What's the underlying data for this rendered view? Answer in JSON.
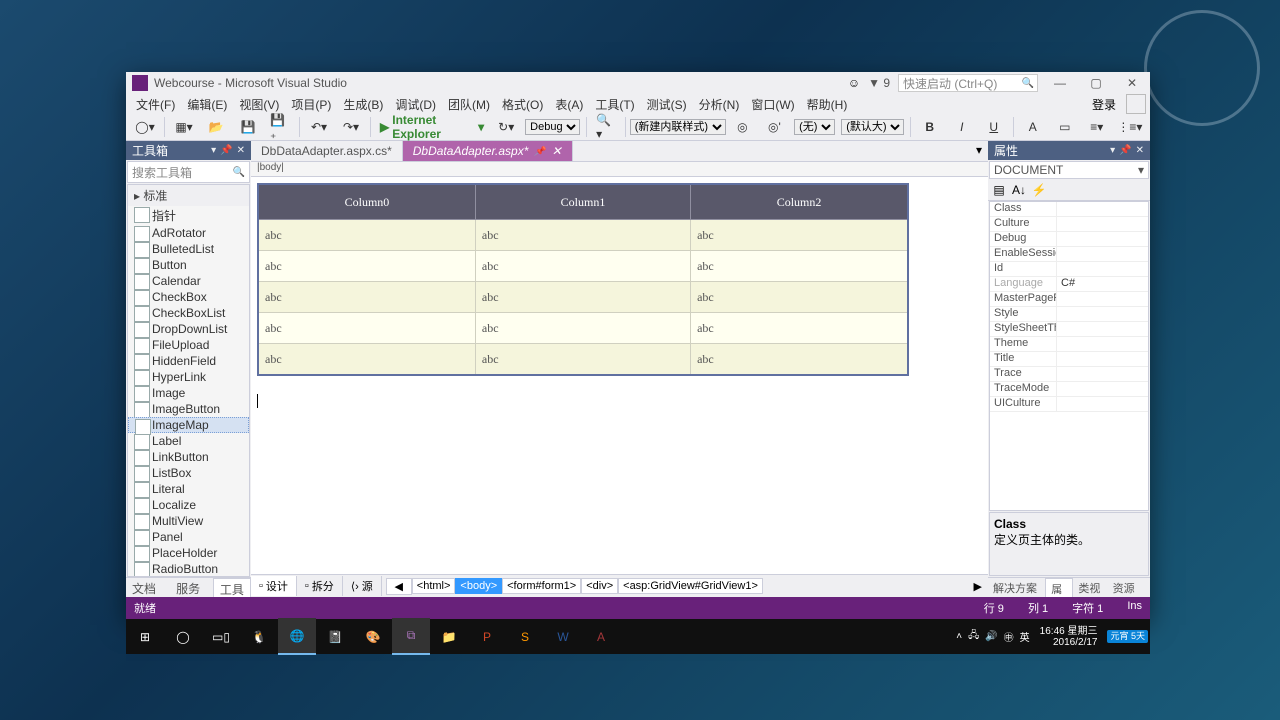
{
  "window": {
    "title": "Webcourse - Microsoft Visual Studio",
    "notif": "▼ 9",
    "quick_launch_ph": "快速启动 (Ctrl+Q)"
  },
  "menu": {
    "items": [
      "文件(F)",
      "编辑(E)",
      "视图(V)",
      "项目(P)",
      "生成(B)",
      "调试(D)",
      "团队(M)",
      "格式(O)",
      "表(A)",
      "工具(T)",
      "测试(S)",
      "分析(N)",
      "窗口(W)",
      "帮助(H)"
    ],
    "login": "登录"
  },
  "toolbar": {
    "run_target": "Internet Explorer",
    "config": "Debug",
    "style": "(新建内联样式)",
    "rule": "(无)",
    "size": "(默认大)"
  },
  "toolbox": {
    "title": "工具箱",
    "search_ph": "搜索工具箱",
    "group": "标准",
    "items": [
      "指针",
      "AdRotator",
      "BulletedList",
      "Button",
      "Calendar",
      "CheckBox",
      "CheckBoxList",
      "DropDownList",
      "FileUpload",
      "HiddenField",
      "HyperLink",
      "Image",
      "ImageButton",
      "ImageMap",
      "Label",
      "LinkButton",
      "ListBox",
      "Literal",
      "Localize",
      "MultiView",
      "Panel",
      "PlaceHolder",
      "RadioButton"
    ],
    "selected": 13,
    "subtabs": [
      "文档大纲",
      "服务器...",
      "工具箱"
    ],
    "subtab_active": 2
  },
  "docs": {
    "tabs": [
      {
        "label": "DbDataAdapter.aspx.cs*"
      },
      {
        "label": "DbDataAdapter.aspx*"
      }
    ],
    "active": 1,
    "crumb": "|body|"
  },
  "grid": {
    "cols": [
      "Column0",
      "Column1",
      "Column2"
    ],
    "cell": "abc",
    "rows": 5
  },
  "viewswitch": {
    "design": "设计",
    "split": "拆分",
    "source": "源",
    "path": [
      "<html>",
      "<body>",
      "<form#form1>",
      "<div>",
      "<asp:GridView#GridView1>"
    ],
    "sel": 1
  },
  "props": {
    "title": "属性",
    "target": "DOCUMENT",
    "rows": [
      {
        "k": "Class"
      },
      {
        "k": "Culture"
      },
      {
        "k": "Debug"
      },
      {
        "k": "EnableSession"
      },
      {
        "k": "Id"
      },
      {
        "k": "Language",
        "v": "C#",
        "dim": true
      },
      {
        "k": "MasterPageFi"
      },
      {
        "k": "Style"
      },
      {
        "k": "StyleSheetThe"
      },
      {
        "k": "Theme"
      },
      {
        "k": "Title"
      },
      {
        "k": "Trace"
      },
      {
        "k": "TraceMode"
      },
      {
        "k": "UICulture"
      }
    ],
    "desc_title": "Class",
    "desc_body": "定义页主体的类。",
    "subtabs": [
      "解决方案资...",
      "属性",
      "类视图",
      "资源视图"
    ],
    "subtab_active": 1
  },
  "status": {
    "ready": "就绪",
    "line": "行 9",
    "col": "列 1",
    "char": "字符 1",
    "ins": "Ins"
  },
  "taskbar": {
    "time": "16:46 星期三",
    "date": "2016/2/17",
    "weather": "元宵 5天",
    "ime": "英",
    "lang": "㊥"
  }
}
